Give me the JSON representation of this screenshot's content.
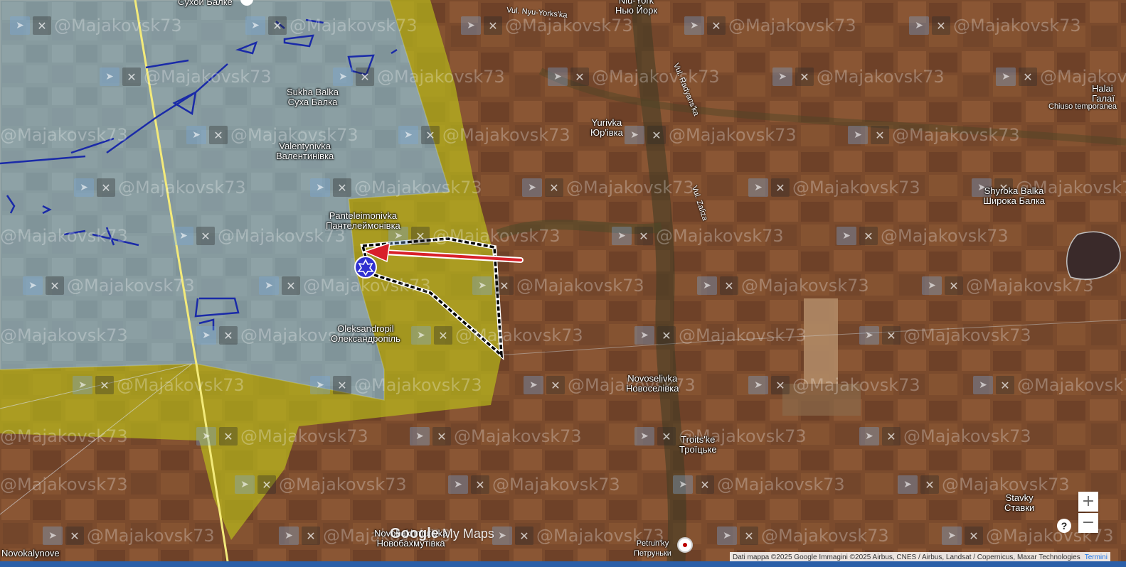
{
  "attribution": {
    "text": "Dati mappa ©2025 Google Immagini ©2025 Airbus, CNES / Airbus, Landsat / Copernicus, Maxar Technologies",
    "terms": "Termini"
  },
  "logo": {
    "google": "Google",
    "mymaps": " My Maps"
  },
  "watermark": "@Majakovsk73",
  "controls": {
    "zoom_in": "+",
    "zoom_out": "−",
    "help": "?"
  },
  "places": [
    {
      "id": "sukha-balka-top",
      "l1": "Сухой Балке",
      "l2": ""
    },
    {
      "id": "niu-york",
      "l1": "Niu-York",
      "l2": "Нью Йорк"
    },
    {
      "id": "sukha-balka",
      "l1": "Sukha Balka",
      "l2": "Суха Балка"
    },
    {
      "id": "valentynivka",
      "l1": "Valentynivka",
      "l2": "Валентинівка"
    },
    {
      "id": "yurivka",
      "l1": "Yurivka",
      "l2": "Юр'івка"
    },
    {
      "id": "panteleimonivka",
      "l1": "Panteleimonivka",
      "l2": "Пантелеймонівка"
    },
    {
      "id": "oleksandropil",
      "l1": "Oleksandropil",
      "l2": "Олександропіль"
    },
    {
      "id": "shyroka-balka",
      "l1": "Shyroka Balka",
      "l2": "Широка Балка"
    },
    {
      "id": "novoselivka",
      "l1": "Novoselivka",
      "l2": "Новоселівка"
    },
    {
      "id": "troitske",
      "l1": "Troits'ke",
      "l2": "Троїцьке"
    },
    {
      "id": "stavky",
      "l1": "Stavky",
      "l2": "Ставки"
    },
    {
      "id": "halai",
      "l1": "Halai",
      "l2": "Галаї"
    },
    {
      "id": "novobakhmutivka",
      "l1": "Novobakhmutivka",
      "l2": "Новобахмутівка"
    },
    {
      "id": "petrunky",
      "l1": "Petrun'ky",
      "l2": "Петруньки"
    },
    {
      "id": "novokalynove",
      "l1": "Novokalynove",
      "l2": ""
    }
  ],
  "notes": {
    "halai_status": "Chiuso temporanea"
  },
  "roads": [
    {
      "id": "vul-niu-yorks-ka",
      "text": "Vul. Nyu-Yorks'ka"
    },
    {
      "id": "vul-radyans-ka",
      "text": "Vul. Radyans'ka"
    },
    {
      "id": "vul-zaliza",
      "text": "Vul. Zaliza"
    }
  ],
  "colors": {
    "terrain": "#7a4a2c",
    "russian_control": "#9cb6d4",
    "grey_zone": "#c8c81e",
    "advance_outline": "#000000",
    "arrow": "#d8202a",
    "unit_marker": "#3a3ad8",
    "trenches": "#1a2aa8",
    "frontline_road": "#e8e070"
  },
  "icons": {
    "unit_marker": "star-badge-icon",
    "arrow": "attack-arrow-icon",
    "telegram": "telegram-icon",
    "x": "x-icon",
    "pin": "location-pin-icon"
  }
}
